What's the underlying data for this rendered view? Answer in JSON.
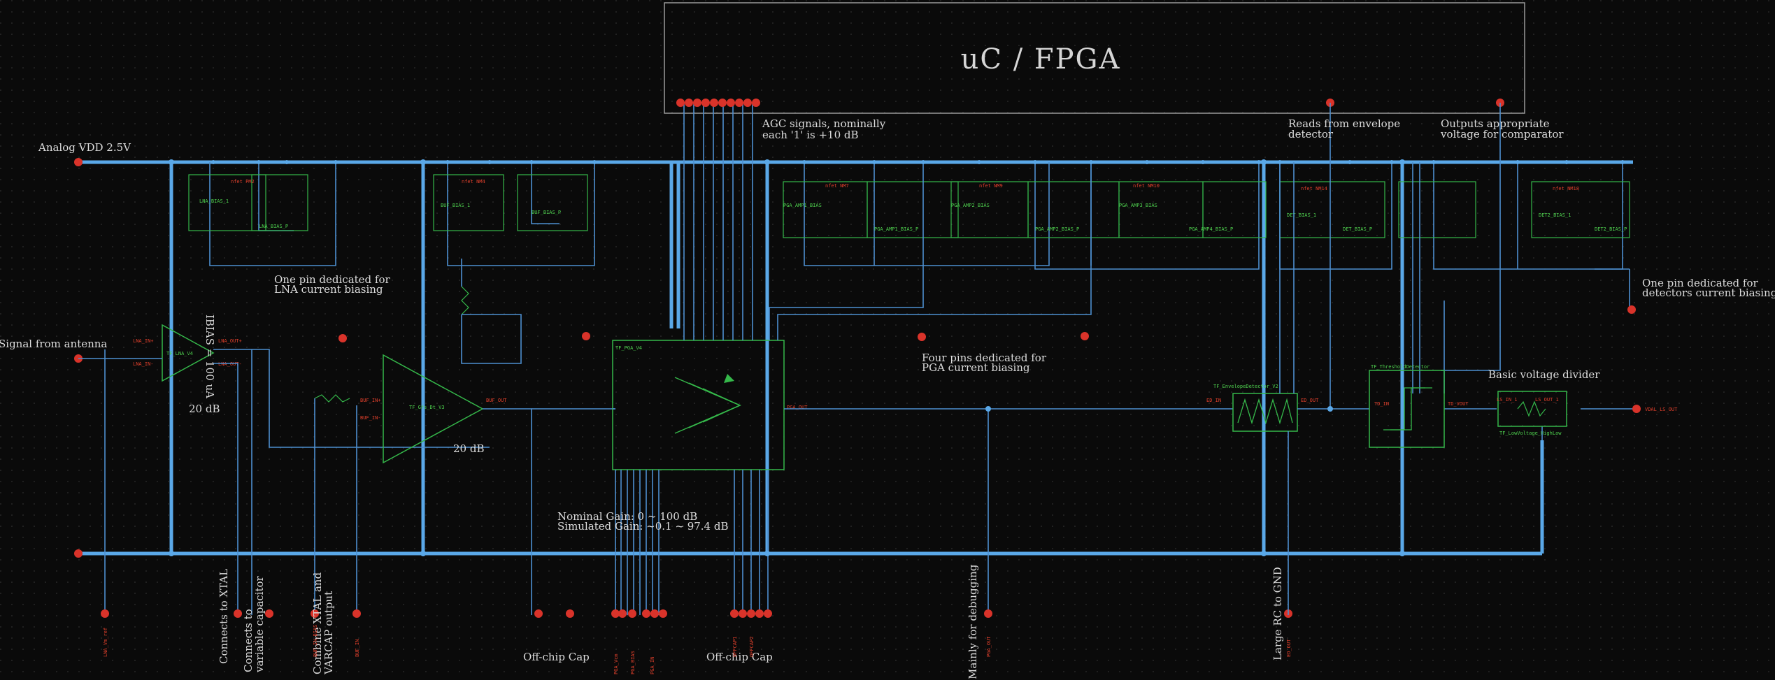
{
  "fpga": {
    "title": "uC / FPGA"
  },
  "rails": {
    "vdd_label": "Analog VDD 2.5V"
  },
  "blocks": {
    "lna_gain": "20 dB",
    "stage2_gain": "20 dB",
    "ibias_label": "IBIAS = 100 uA"
  },
  "notes": {
    "antenna": "Signal from antenna",
    "agc_line1": "AGC signals, nominally",
    "agc_line2": "each '1' is +10 dB",
    "lna_pin_line1": "One pin dedicated for",
    "lna_pin_line2": "LNA current biasing",
    "pga_pin_line1": "Four pins dedicated for",
    "pga_pin_line2": "PGA current biasing",
    "envelope_line1": "Reads from envelope",
    "envelope_line2": "detector",
    "comparator_line1": "Outputs appropriate",
    "comparator_line2": "voltage for comparator",
    "divider": "Basic voltage divider",
    "det_pin_line1": "One pin dedicated for",
    "det_pin_line2": "detectors current biasing",
    "gain_nominal": "Nominal Gain: 0 ~ 100 dB",
    "gain_simulated": "Simulated Gain: ~0.1 ~ 97.4 dB",
    "offchip1": "Off-chip Cap",
    "offchip2": "Off-chip Cap",
    "xtal": "Connects to XTAL",
    "varcap_line1": "Connects to",
    "varcap_line2": "variable capacitor",
    "combine_line1": "Combine XTAL and",
    "combine_line2": "VARCAP output",
    "debug": "Mainly for debugging",
    "large_rc": "Large RC to GND"
  },
  "colors": {
    "background": "#0a0a0a",
    "rail": "#5aa8e8",
    "wire": "#4d8fd0",
    "component": "#35b84a",
    "pin": "#d9332a",
    "text": "#dcdcdc",
    "frame": "#9a9a9a"
  }
}
